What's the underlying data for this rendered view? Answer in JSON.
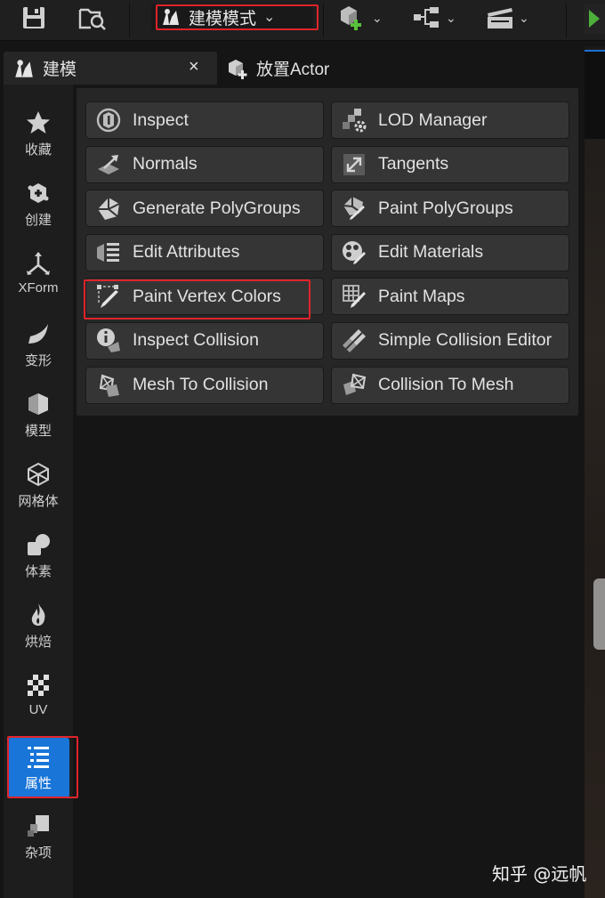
{
  "toolbar": {
    "mode_label": "建模模式",
    "mode_chevron": "⌄",
    "dropdown_chevron": "⌄"
  },
  "tabs": [
    {
      "label": "建模",
      "active": true,
      "close": "×"
    },
    {
      "label": "放置Actor",
      "active": false
    }
  ],
  "categories": [
    {
      "label": "收藏",
      "icon": "star-icon"
    },
    {
      "label": "创建",
      "icon": "create-icon"
    },
    {
      "label": "XForm",
      "icon": "xform-icon"
    },
    {
      "label": "变形",
      "icon": "deform-icon"
    },
    {
      "label": "模型",
      "icon": "model-icon"
    },
    {
      "label": "网格体",
      "icon": "mesh-icon"
    },
    {
      "label": "体素",
      "icon": "voxel-icon"
    },
    {
      "label": "烘焙",
      "icon": "bake-icon"
    },
    {
      "label": "UV",
      "icon": "uv-icon"
    },
    {
      "label": "属性",
      "icon": "attributes-icon",
      "active": true
    },
    {
      "label": "杂项",
      "icon": "misc-icon"
    }
  ],
  "tools": [
    {
      "label": "Inspect",
      "icon": "inspect-icon"
    },
    {
      "label": "LOD Manager",
      "icon": "lod-manager-icon"
    },
    {
      "label": "Normals",
      "icon": "normals-icon"
    },
    {
      "label": "Tangents",
      "icon": "tangents-icon"
    },
    {
      "label": "Generate PolyGroups",
      "icon": "generate-polygroups-icon"
    },
    {
      "label": "Paint PolyGroups",
      "icon": "paint-polygroups-icon"
    },
    {
      "label": "Edit Attributes",
      "icon": "edit-attributes-icon"
    },
    {
      "label": "Edit Materials",
      "icon": "edit-materials-icon"
    },
    {
      "label": "Paint Vertex Colors",
      "icon": "paint-vertex-colors-icon"
    },
    {
      "label": "Paint Maps",
      "icon": "paint-maps-icon"
    },
    {
      "label": "Inspect Collision",
      "icon": "inspect-collision-icon"
    },
    {
      "label": "Simple Collision Editor",
      "icon": "simple-collision-editor-icon"
    },
    {
      "label": "Mesh To Collision",
      "icon": "mesh-to-collision-icon"
    },
    {
      "label": "Collision To Mesh",
      "icon": "collision-to-mesh-icon"
    }
  ],
  "watermark": "知乎 @远帆",
  "colors": {
    "accent": "#1975d8",
    "highlight": "#e0242b",
    "add_green": "#59c23b",
    "play_green": "#4caf3a"
  }
}
